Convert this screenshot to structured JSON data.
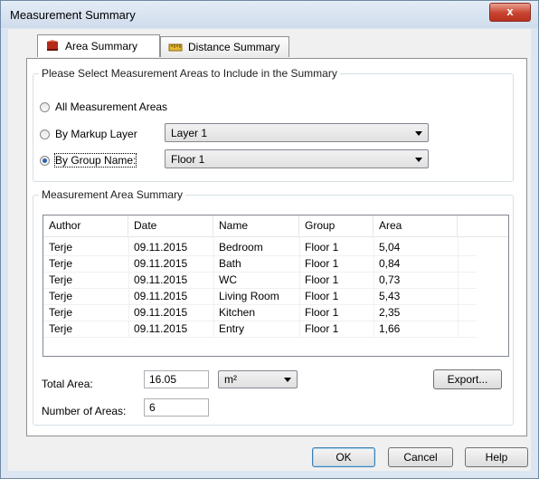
{
  "window": {
    "title": "Measurement Summary",
    "close_label": "x"
  },
  "tabs": [
    {
      "label": "Area Summary",
      "icon": "area-icon",
      "active": true
    },
    {
      "label": "Distance Summary",
      "icon": "distance-icon",
      "active": false
    }
  ],
  "select_group": {
    "title": "Please Select Measurement Areas to Include in the Summary",
    "all_label": "All Measurement Areas",
    "layer_label": "By Markup Layer",
    "layer_value": "Layer 1",
    "group_label": "By Group Name:",
    "group_value": "Floor 1",
    "selected": "group"
  },
  "summary": {
    "title": "Measurement Area Summary",
    "columns": [
      "Author",
      "Date",
      "Name",
      "Group",
      "Area"
    ],
    "rows": [
      [
        "Terje",
        "09.11.2015",
        "Bedroom",
        "Floor 1",
        "5,04"
      ],
      [
        "Terje",
        "09.11.2015",
        "Bath",
        "Floor 1",
        "0,84"
      ],
      [
        "Terje",
        "09.11.2015",
        "WC",
        "Floor 1",
        "0,73"
      ],
      [
        "Terje",
        "09.11.2015",
        "Living Room",
        "Floor 1",
        "5,43"
      ],
      [
        "Terje",
        "09.11.2015",
        "Kitchen",
        "Floor 1",
        "2,35"
      ],
      [
        "Terje",
        "09.11.2015",
        "Entry",
        "Floor 1",
        "1,66"
      ]
    ],
    "total_label": "Total Area:",
    "total_value": "16.05",
    "unit_value": "m²",
    "count_label": "Number of Areas:",
    "count_value": "6",
    "export_label": "Export..."
  },
  "buttons": {
    "ok": "OK",
    "cancel": "Cancel",
    "help": "Help"
  },
  "colors": {
    "accent": "#2c62b0",
    "close": "#c8432f",
    "area_icon": "#8a1a10",
    "distance_icon": "#d0a020"
  }
}
